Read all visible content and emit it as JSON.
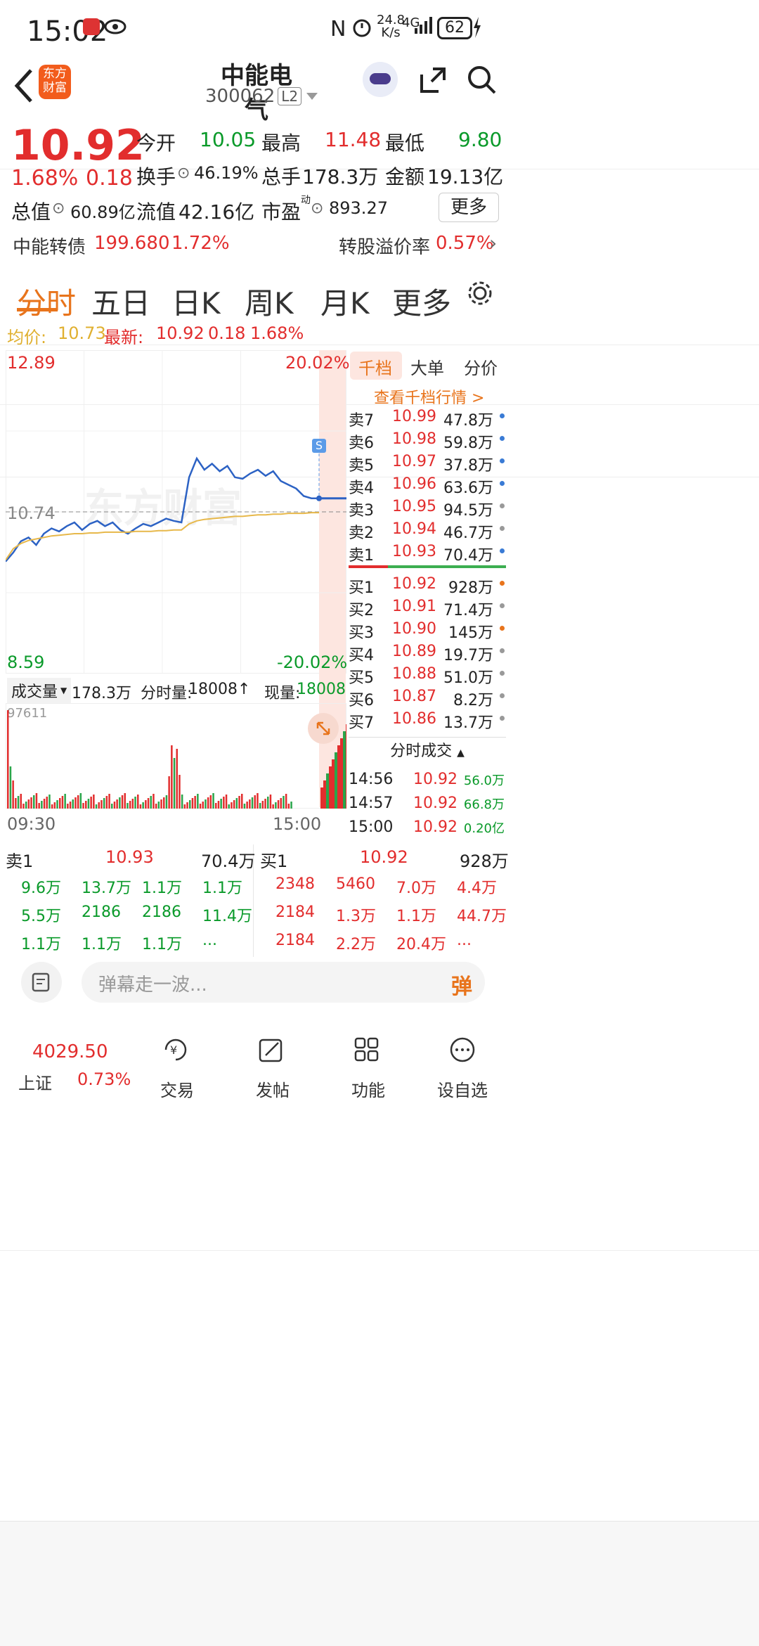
{
  "status": {
    "time": "15:02",
    "net_speed": "24.8",
    "net_unit": "K/s",
    "signal": "4G",
    "battery": "62"
  },
  "header": {
    "stock_name": "中能电气",
    "stock_code": "300062",
    "level": "L2",
    "brand": "东方财富"
  },
  "quote": {
    "price": "10.92",
    "pct": "1.68%",
    "change": "0.18",
    "open_label": "今开",
    "open": "10.05",
    "high_label": "最高",
    "high": "11.48",
    "low_label": "最低",
    "low": "9.80",
    "turnover_label": "换手",
    "turnover": "46.19%",
    "volume_label": "总手",
    "volume": "178.3万",
    "amount_label": "金额",
    "amount": "19.13亿",
    "mktcap_label": "总值",
    "mktcap": "60.89亿",
    "float_label": "流值",
    "float": "42.16亿",
    "pe_label": "市盈",
    "pe_sup": "动",
    "pe": "893.27",
    "more_button": "更多"
  },
  "bond": {
    "name": "中能转债",
    "price": "199.680",
    "pct": "1.72%",
    "premium_label": "转股溢价率",
    "premium": "0.57%"
  },
  "tabs": [
    "分时",
    "五日",
    "日K",
    "周K",
    "月K",
    "更多"
  ],
  "avg_line": {
    "avg_label": "均价:",
    "avg": "10.73",
    "last_label": "最新:",
    "last": "10.92",
    "change": "0.18",
    "pct": "1.68%"
  },
  "chart": {
    "ymax": "12.89",
    "ymax_pct": "20.02%",
    "ymid": "10.74",
    "ymin": "8.59",
    "ymin_pct": "-20.02%",
    "watermark": "东方财富",
    "signal_badge": "S",
    "vol_label": "成交量",
    "vol_total": "178.3万",
    "minute_vol_label": "分时量:",
    "minute_vol": "18008↑",
    "cur_vol_label": "现量:",
    "cur_vol": "18008",
    "vol_max": "97611",
    "time_start": "09:30",
    "time_end": "15:00"
  },
  "chart_data": {
    "type": "line",
    "series": [
      {
        "name": "最新",
        "values": [
          10.08,
          10.2,
          10.35,
          10.4,
          10.3,
          10.45,
          10.52,
          10.48,
          10.55,
          10.6,
          10.5,
          10.58,
          10.62,
          10.55,
          10.6,
          10.5,
          10.45,
          10.52,
          10.58,
          10.55,
          10.6,
          10.65,
          10.62,
          10.6,
          11.2,
          11.45,
          11.3,
          11.38,
          11.28,
          11.35,
          11.2,
          11.18,
          11.25,
          11.3,
          11.22,
          11.28,
          11.15,
          11.1,
          11.05,
          10.95,
          10.92,
          10.92
        ]
      },
      {
        "name": "均价",
        "values": [
          10.1,
          10.25,
          10.32,
          10.36,
          10.38,
          10.4,
          10.42,
          10.43,
          10.44,
          10.45,
          10.45,
          10.46,
          10.46,
          10.47,
          10.47,
          10.47,
          10.47,
          10.48,
          10.48,
          10.48,
          10.49,
          10.49,
          10.5,
          10.5,
          10.58,
          10.62,
          10.64,
          10.65,
          10.66,
          10.67,
          10.68,
          10.68,
          10.69,
          10.7,
          10.7,
          10.71,
          10.71,
          10.72,
          10.72,
          10.72,
          10.73,
          10.73
        ]
      }
    ],
    "ylim": [
      8.59,
      12.89
    ]
  },
  "depth": {
    "tabs": [
      "千档",
      "大单",
      "分价"
    ],
    "link": "查看千档行情 >",
    "asks": [
      {
        "label": "卖7",
        "price": "10.99",
        "vol": "47.8万",
        "dot": "#3a7bd5"
      },
      {
        "label": "卖6",
        "price": "10.98",
        "vol": "59.8万",
        "dot": "#3a7bd5"
      },
      {
        "label": "卖5",
        "price": "10.97",
        "vol": "37.8万",
        "dot": "#3a7bd5"
      },
      {
        "label": "卖4",
        "price": "10.96",
        "vol": "63.6万",
        "dot": "#3a7bd5"
      },
      {
        "label": "卖3",
        "price": "10.95",
        "vol": "94.5万",
        "dot": "#999999"
      },
      {
        "label": "卖2",
        "price": "10.94",
        "vol": "46.7万",
        "dot": "#999999"
      },
      {
        "label": "卖1",
        "price": "10.93",
        "vol": "70.4万",
        "dot": "#3a7bd5"
      }
    ],
    "bids": [
      {
        "label": "买1",
        "price": "10.92",
        "vol": "928万",
        "dot": "#e8741c"
      },
      {
        "label": "买2",
        "price": "10.91",
        "vol": "71.4万",
        "dot": "#999999"
      },
      {
        "label": "买3",
        "price": "10.90",
        "vol": "145万",
        "dot": "#e8741c"
      },
      {
        "label": "买4",
        "price": "10.89",
        "vol": "19.7万",
        "dot": "#999999"
      },
      {
        "label": "买5",
        "price": "10.88",
        "vol": "51.0万",
        "dot": "#999999"
      },
      {
        "label": "买6",
        "price": "10.87",
        "vol": "8.2万",
        "dot": "#999999"
      },
      {
        "label": "买7",
        "price": "10.86",
        "vol": "13.7万",
        "dot": "#999999"
      }
    ],
    "ticks_title": "分时成交",
    "ticks": [
      {
        "time": "14:56",
        "price": "10.92",
        "vol": "56.0万"
      },
      {
        "time": "14:57",
        "price": "10.92",
        "vol": "66.8万"
      },
      {
        "time": "15:00",
        "price": "10.92",
        "vol": "0.20亿"
      }
    ]
  },
  "queue": {
    "sell": {
      "label": "卖1",
      "price": "10.93",
      "vol": "70.4万",
      "rows": [
        [
          "9.6万",
          "13.7万",
          "1.1万",
          "1.1万"
        ],
        [
          "5.5万",
          "2186",
          "2186",
          "11.4万"
        ],
        [
          "1.1万",
          "1.1万",
          "1.1万",
          "..."
        ]
      ]
    },
    "buy": {
      "label": "买1",
      "price": "10.92",
      "vol": "928万",
      "rows": [
        [
          "2348",
          "5460",
          "7.0万",
          "4.4万"
        ],
        [
          "2184",
          "1.3万",
          "1.1万",
          "44.7万"
        ],
        [
          "2184",
          "2.2万",
          "20.4万",
          "..."
        ]
      ]
    }
  },
  "comment": {
    "placeholder": "弹幕走一波...",
    "danmu_btn": "弹"
  },
  "nav": {
    "index_value": "4029.50",
    "index_name": "上证",
    "index_pct": "0.73%",
    "items": [
      "交易",
      "发帖",
      "功能",
      "设自选"
    ]
  }
}
